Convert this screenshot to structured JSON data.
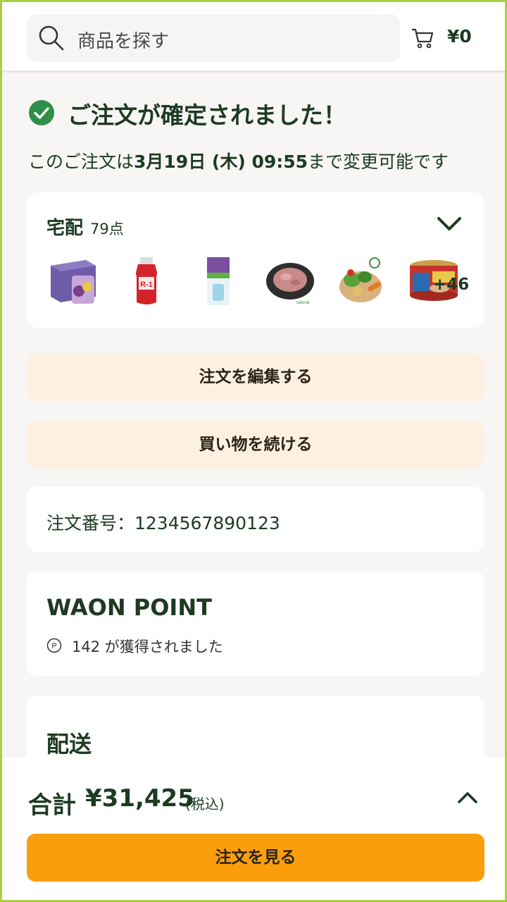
{
  "header": {
    "search_placeholder": "商品を探す",
    "cart_total": "¥0"
  },
  "confirmation": {
    "title": "ご注文が確定されました！",
    "sub_prefix": "このご注文は",
    "sub_deadline": "3月19日 (木) 09:55",
    "sub_suffix": "まで変更可能です"
  },
  "delivery": {
    "label": "宅配",
    "count": "79点",
    "more_count": "+46",
    "thumbnails": [
      {
        "icon": "jelly-drink-box-icon"
      },
      {
        "icon": "yogurt-drink-bottle-icon"
      },
      {
        "icon": "mouthwash-bottle-icon"
      },
      {
        "icon": "ground-meat-tray-icon"
      },
      {
        "icon": "vegetables-basket-icon"
      },
      {
        "icon": "canned-food-icon"
      }
    ]
  },
  "actions": {
    "edit_order": "注文を編集する",
    "continue_shopping": "買い物を続ける"
  },
  "order": {
    "number_label": "注文番号：1234567890123"
  },
  "waon": {
    "title": "WAON POINT",
    "points_text": "142 が獲得されました"
  },
  "shipping": {
    "title": "配送"
  },
  "footer": {
    "total_label": "合計",
    "total_value": "¥31,425",
    "tax_note": "(税込)",
    "view_order": "注文を見る"
  },
  "colors": {
    "brand_green": "#1d3a22",
    "check_green": "#2f8f47",
    "accent_orange": "#fb9e0c",
    "light_orange": "#fdf0e1",
    "frame_green": "#a8cf45"
  }
}
